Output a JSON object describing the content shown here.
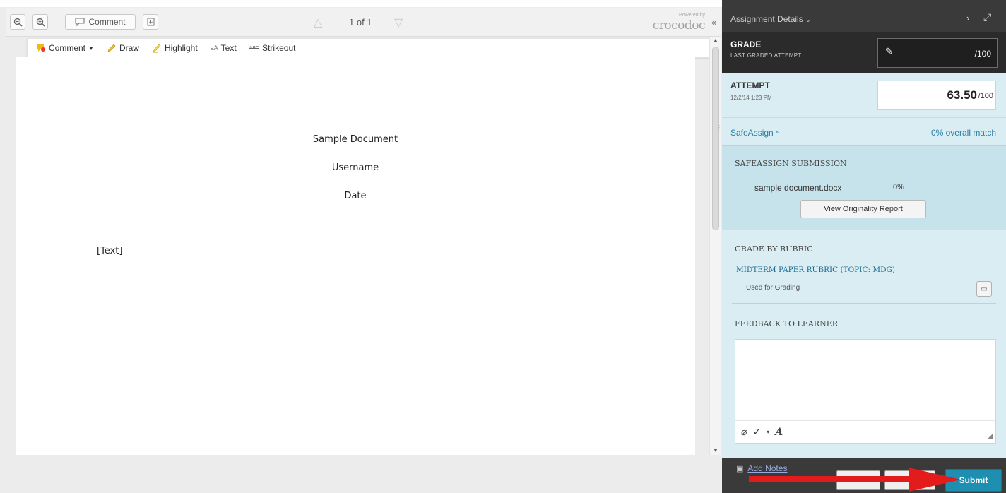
{
  "viewer": {
    "toolbar": {
      "comment_label": "Comment",
      "page_label": "1 of 1",
      "powered_by": "Powered by",
      "brand": "crocodoc"
    },
    "annotation_bar": {
      "items": [
        {
          "label": "Comment",
          "icon": "comment-icon"
        },
        {
          "label": "Draw",
          "icon": "pencil-icon"
        },
        {
          "label": "Highlight",
          "icon": "highlighter-icon"
        },
        {
          "label": "Text",
          "icon": "text-icon"
        },
        {
          "label": "Strikeout",
          "icon": "strikeout-icon"
        }
      ]
    },
    "document": {
      "title": "Sample Document",
      "username": "Username",
      "date": "Date",
      "body": "[Text]"
    }
  },
  "panel": {
    "header_title": "Assignment Details",
    "grade": {
      "label": "GRADE",
      "sublabel": "LAST GRADED ATTEMPT",
      "max": "/100"
    },
    "attempt": {
      "label": "ATTEMPT",
      "date": "12/2/14 1:23 PM",
      "score": "63.50",
      "max": "/100"
    },
    "safeassign": {
      "toggle_label": "SafeAssign",
      "overall_match": "0% overall match",
      "heading": "SAFEASSIGN SUBMISSION",
      "file": "sample document.docx",
      "percent": "0%",
      "report_button": "View Originality Report"
    },
    "rubric": {
      "heading": "GRADE BY RUBRIC",
      "link": "MIDTERM PAPER RUBRIC (TOPIC: MDG)",
      "used": "Used for Grading"
    },
    "feedback": {
      "heading": "FEEDBACK TO LEARNER"
    },
    "footer": {
      "add_notes": "Add Notes",
      "submit": "Submit"
    }
  },
  "colors": {
    "panel_bg": "#d9edf3",
    "panel_dark": "#3a3a3a",
    "submit": "#1f8fb1",
    "arrow": "#e31b1b",
    "link": "#1c6d93"
  }
}
